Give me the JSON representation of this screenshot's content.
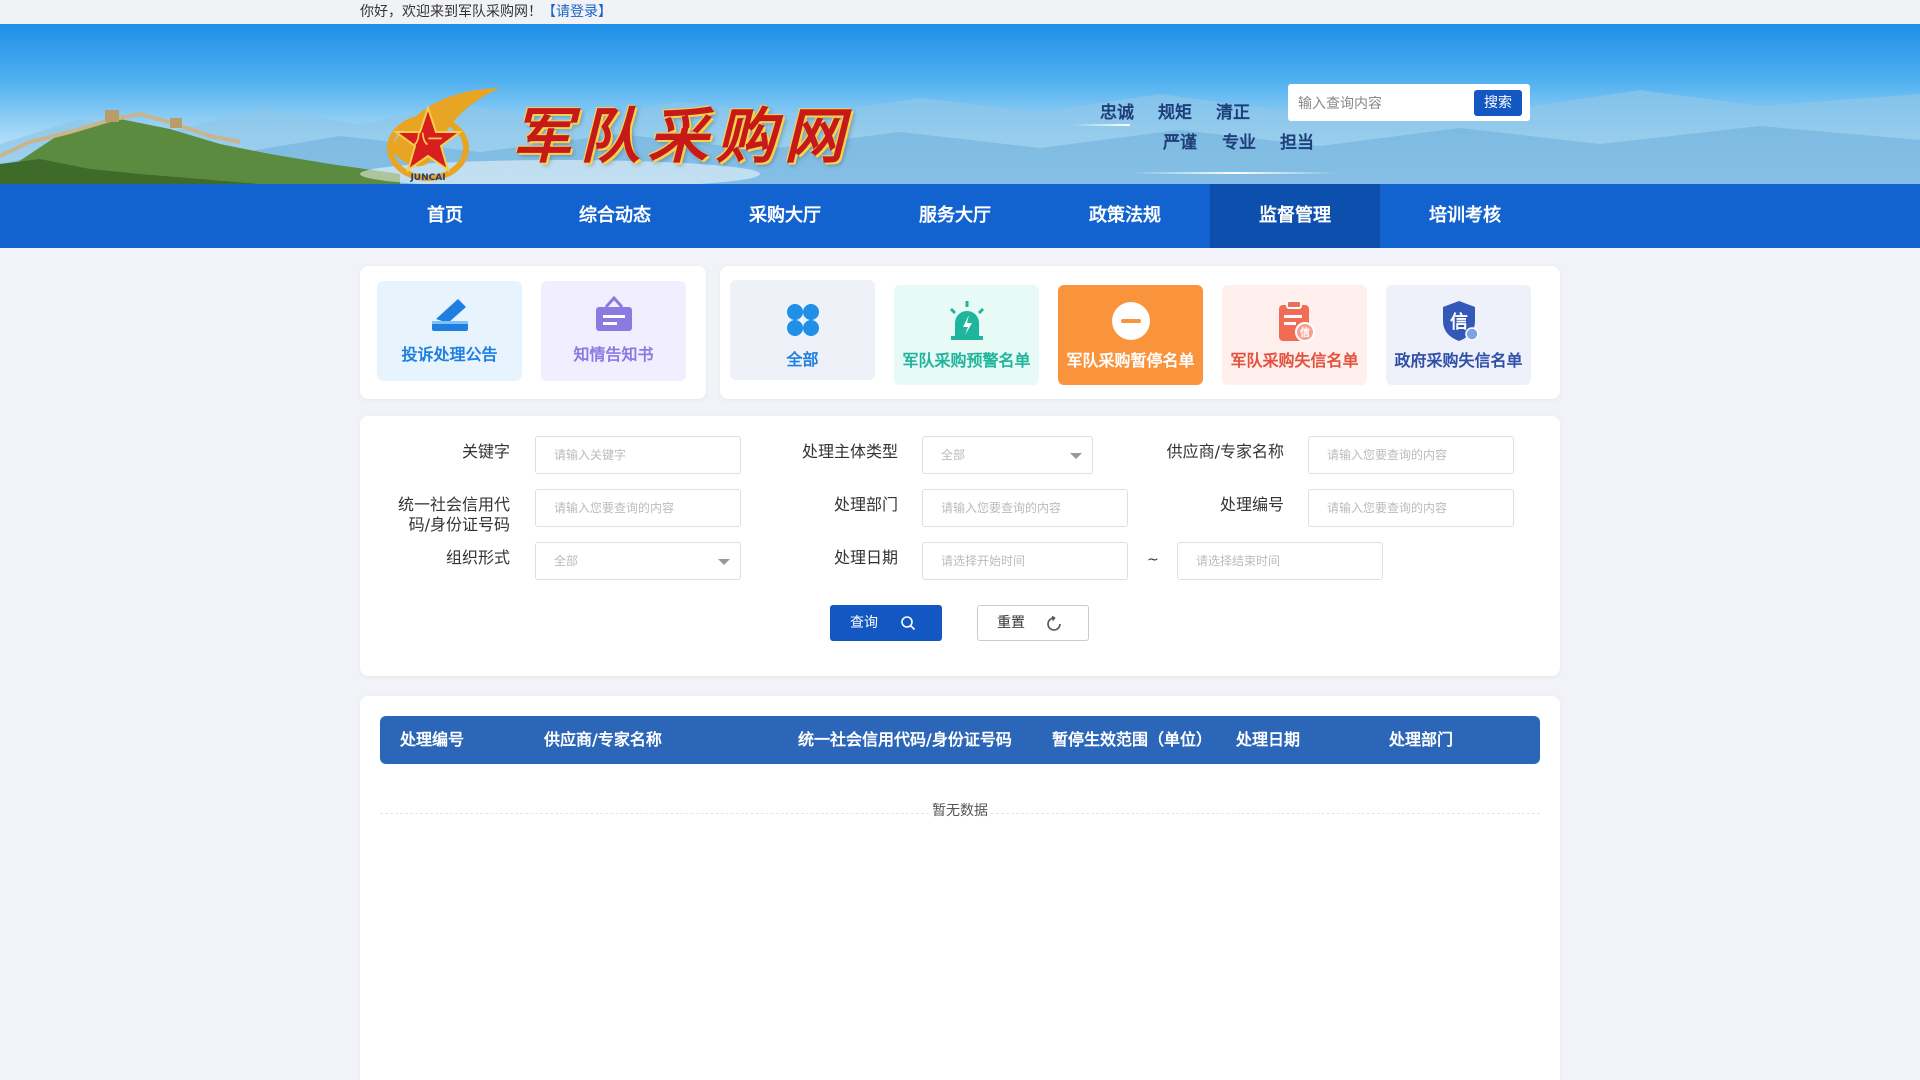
{
  "topbar": {
    "welcome": "你好，欢迎来到军队采购网！",
    "login": "【请登录】"
  },
  "header": {
    "site_title": "军队采购网",
    "slogans_row1": [
      "忠诚",
      "规矩",
      "清正"
    ],
    "slogans_row2": [
      "严谨",
      "专业",
      "担当"
    ],
    "search": {
      "placeholder": "输入查询内容",
      "button": "搜索"
    }
  },
  "nav": {
    "items": [
      {
        "label": "首页"
      },
      {
        "label": "综合动态"
      },
      {
        "label": "采购大厅"
      },
      {
        "label": "服务大厅"
      },
      {
        "label": "政策法规"
      },
      {
        "label": "监督管理",
        "active": true
      },
      {
        "label": "培训考核"
      }
    ]
  },
  "left_tiles": [
    {
      "label": "投诉处理公告",
      "color": "#1f7fe0",
      "bg": "#e8f4fd",
      "icon": "ballot-box-icon"
    },
    {
      "label": "知情告知书",
      "color": "#8b7be0",
      "bg": "#f1efff",
      "icon": "notice-board-icon"
    }
  ],
  "right_tiles": [
    {
      "label": "全部",
      "color": "#1f7fe0",
      "bg": "#eef1f8",
      "icon": "grid-icon"
    },
    {
      "label": "军队采购预警名单",
      "color": "#1fb59c",
      "bg": "#e7faf6",
      "icon": "alarm-icon"
    },
    {
      "label": "军队采购暂停名单",
      "color": "#ffffff",
      "bg": "#f9933c",
      "icon": "minus-circle-icon"
    },
    {
      "label": "军队采购失信名单",
      "color": "#e5513c",
      "bg": "#fff0ee",
      "icon": "clipboard-icon"
    },
    {
      "label": "政府采购失信名单",
      "color": "#2f4fa8",
      "bg": "#eef1fa",
      "icon": "shield-credit-icon"
    }
  ],
  "filters": {
    "keyword": {
      "label": "关键字",
      "placeholder": "请输入关键字"
    },
    "subject_type": {
      "label": "处理主体类型",
      "value": "全部"
    },
    "supplier_name": {
      "label": "供应商/专家名称",
      "placeholder": "请输入您要查询的内容"
    },
    "credit_code": {
      "label_line1": "统一社会信用代",
      "label_line2": "码/身份证号码",
      "placeholder": "请输入您要查询的内容"
    },
    "department": {
      "label": "处理部门",
      "placeholder": "请输入您要查询的内容"
    },
    "case_number": {
      "label": "处理编号",
      "placeholder": "请输入您要查询的内容"
    },
    "org_form": {
      "label": "组织形式",
      "value": "全部"
    },
    "date": {
      "label": "处理日期",
      "start_placeholder": "请选择开始时间",
      "separator": "~",
      "end_placeholder": "请选择结束时间"
    },
    "query_button": "查询",
    "reset_button": "重置"
  },
  "table": {
    "columns": [
      "处理编号",
      "供应商/专家名称",
      "统一社会信用代码/身份证号码",
      "暂停生效范围（单位）",
      "处理日期",
      "处理部门"
    ],
    "empty_text": "暂无数据"
  },
  "colors": {
    "primary": "#1357c2",
    "nav": "#1262cf",
    "nav_active": "#0d4fac",
    "table_head": "#2c66b8"
  }
}
